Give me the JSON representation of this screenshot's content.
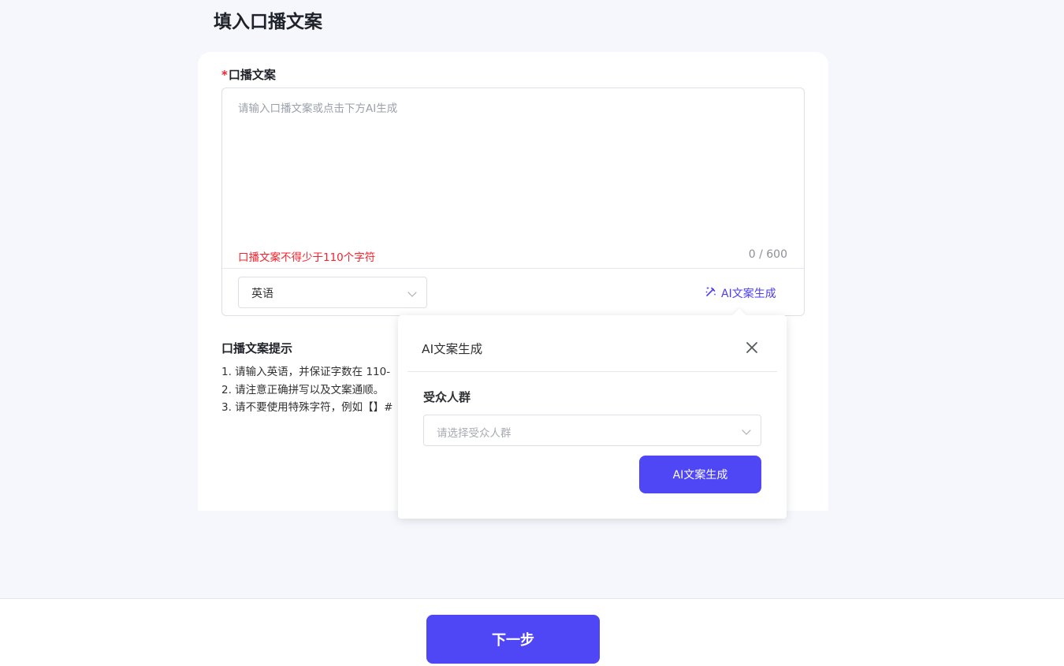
{
  "page": {
    "title": "填入口播文案"
  },
  "script_field": {
    "required_mark": "*",
    "label": "口播文案",
    "placeholder": "请输入口播文案或点击下方AI生成",
    "value": "",
    "error": "口播文案不得少于110个字符",
    "counter": "0 / 600",
    "language": {
      "selected": "英语"
    },
    "ai_link_label": "AI文案生成"
  },
  "tips": {
    "title": "口播文案提示",
    "items": [
      "1. 请输入英语，并保证字数在 110-",
      "2. 请注意正确拼写以及文案通顺。",
      "3. 请不要使用特殊字符，例如【】#"
    ]
  },
  "ai_popover": {
    "title": "AI文案生成",
    "audience_label": "受众人群",
    "audience_placeholder": "请选择受众人群",
    "generate_label": "AI文案生成"
  },
  "footer": {
    "next_label": "下一步"
  },
  "colors": {
    "accent": "#4f46f5",
    "error": "#f5222d",
    "background": "#f5f7fd"
  }
}
